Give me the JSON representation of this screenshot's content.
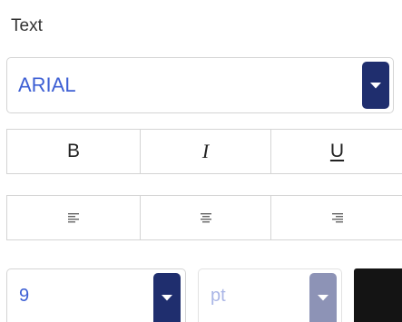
{
  "text_section": {
    "title": "Text",
    "font": {
      "value": "ARIAL",
      "arrow_icon": "caret-down-icon"
    },
    "style_buttons": [
      {
        "label": "B",
        "icon": "bold-icon"
      },
      {
        "label": "I",
        "icon": "italic-icon"
      },
      {
        "label": "U",
        "icon": "underline-icon"
      }
    ],
    "align_buttons": [
      {
        "icon": "align-left-icon"
      },
      {
        "icon": "align-center-icon"
      },
      {
        "icon": "align-right-icon"
      }
    ],
    "size": {
      "value": "9",
      "arrow_icon": "caret-down-icon"
    },
    "unit": {
      "placeholder": "pt",
      "arrow_icon": "caret-down-icon"
    },
    "color": {
      "value": "#141414"
    }
  },
  "colors": {
    "accent": "#1f2e6e",
    "accent_disabled": "#8d93b6",
    "value_text": "#3d5fd4",
    "border": "#d4d4d4"
  }
}
